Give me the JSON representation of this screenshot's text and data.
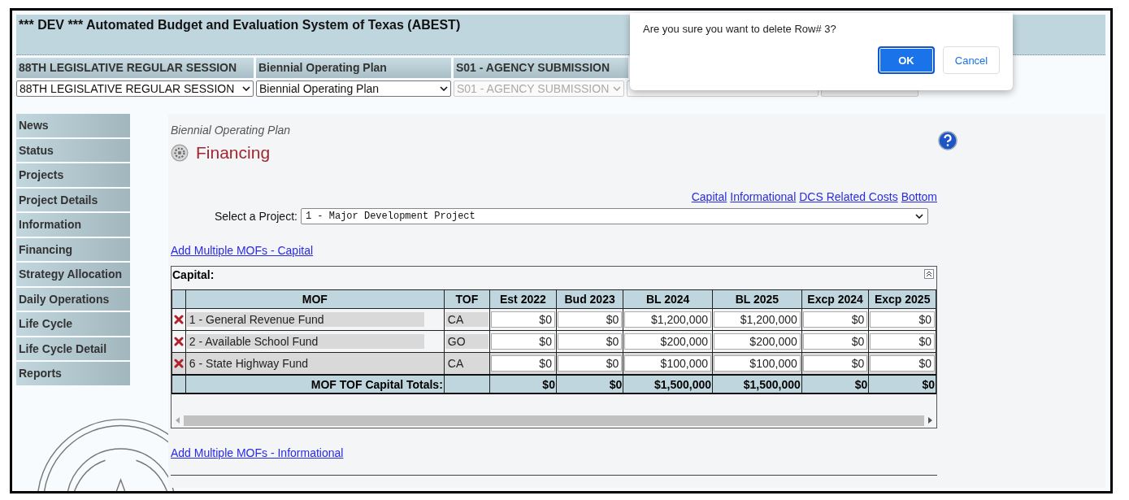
{
  "header": {
    "title": "*** DEV *** Automated Budget and Evaluation System of Texas (ABEST)"
  },
  "session": {
    "headers": [
      "88TH LEGISLATIVE REGULAR SESSION",
      "Biennial Operating Plan",
      "S01 - AGENCY SUBMISSION"
    ],
    "selects": [
      {
        "value": "88TH LEGISLATIVE REGULAR SESSION",
        "disabled": false
      },
      {
        "value": "Biennial Operating Plan",
        "disabled": false
      },
      {
        "value": "S01 - AGENCY SUBMISSION",
        "disabled": true
      }
    ]
  },
  "sidebar": {
    "items": [
      "News",
      "Status",
      "Projects",
      "Project Details",
      "Information",
      "Financing",
      "Strategy Allocation",
      "Daily Operations",
      "Life Cycle",
      "Life Cycle Detail",
      "Reports"
    ]
  },
  "main": {
    "subtitle": "Biennial Operating Plan",
    "title": "Financing",
    "links": [
      "Capital",
      "Informational",
      "DCS Related Costs",
      "Bottom"
    ],
    "project": {
      "label": "Select a Project:",
      "value": "1 - Major Development Project"
    },
    "add_capital_link": "Add Multiple MOFs - Capital",
    "capital": {
      "title": "Capital:",
      "columns": [
        "MOF",
        "TOF",
        "Est 2022",
        "Bud 2023",
        "BL 2024",
        "BL 2025",
        "Excp 2024",
        "Excp 2025"
      ],
      "rows": [
        {
          "mof": "1 - General Revenue Fund",
          "tof": "CA",
          "values": [
            "$0",
            "$0",
            "$1,200,000",
            "$1,200,000",
            "$0",
            "$0"
          ],
          "highlighted": false
        },
        {
          "mof": "2 - Available School Fund",
          "tof": "GO",
          "values": [
            "$0",
            "$0",
            "$200,000",
            "$200,000",
            "$0",
            "$0"
          ],
          "highlighted": false
        },
        {
          "mof": "6 - State Highway Fund",
          "tof": "CA",
          "values": [
            "$0",
            "$0",
            "$100,000",
            "$100,000",
            "$0",
            "$0"
          ],
          "highlighted": true
        }
      ],
      "totals": {
        "label": "MOF TOF Capital Totals:",
        "values": [
          "$0",
          "$0",
          "$1,500,000",
          "$1,500,000",
          "$0",
          "$0"
        ]
      }
    },
    "add_informational_link": "Add Multiple MOFs - Informational"
  },
  "dialog": {
    "message": "Are you sure you want to delete Row# 3?",
    "buttons": [
      {
        "label": "OK",
        "kind": "primary"
      },
      {
        "label": "Cancel",
        "kind": "secondary"
      }
    ]
  }
}
